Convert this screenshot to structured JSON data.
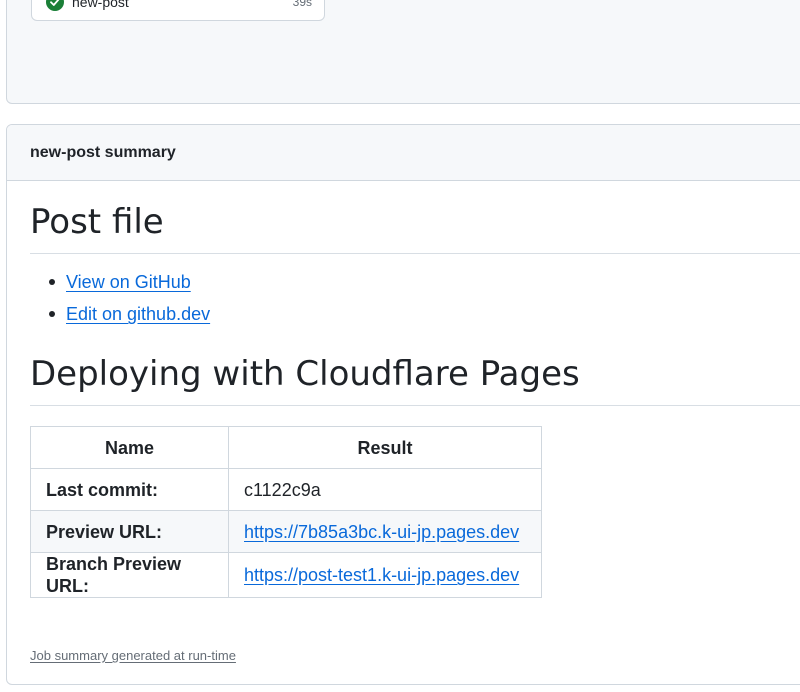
{
  "top_panel": {
    "job": {
      "name": "new-post",
      "duration": "39s",
      "status": "success"
    }
  },
  "summary": {
    "header_title": "new-post summary",
    "post_file": {
      "heading": "Post file",
      "links": [
        {
          "label": "View on GitHub"
        },
        {
          "label": "Edit on github.dev"
        }
      ]
    },
    "deploy": {
      "heading": "Deploying with Cloudflare Pages",
      "columns": [
        "Name",
        "Result"
      ],
      "rows": [
        {
          "name": "Last commit:",
          "result": "c1122c9a",
          "is_link": false
        },
        {
          "name": "Preview URL:",
          "result": "https://7b85a3bc.k-ui-jp.pages.dev",
          "is_link": true
        },
        {
          "name": "Branch Preview URL:",
          "result": "https://post-test1.k-ui-jp.pages.dev",
          "is_link": true
        }
      ]
    },
    "footer_note": "Job summary generated at run-time"
  },
  "icons": {
    "job_status": "check-circle-icon"
  },
  "colors": {
    "link": "#0969da",
    "success": "#1a7f37",
    "border": "#d0d7de"
  }
}
